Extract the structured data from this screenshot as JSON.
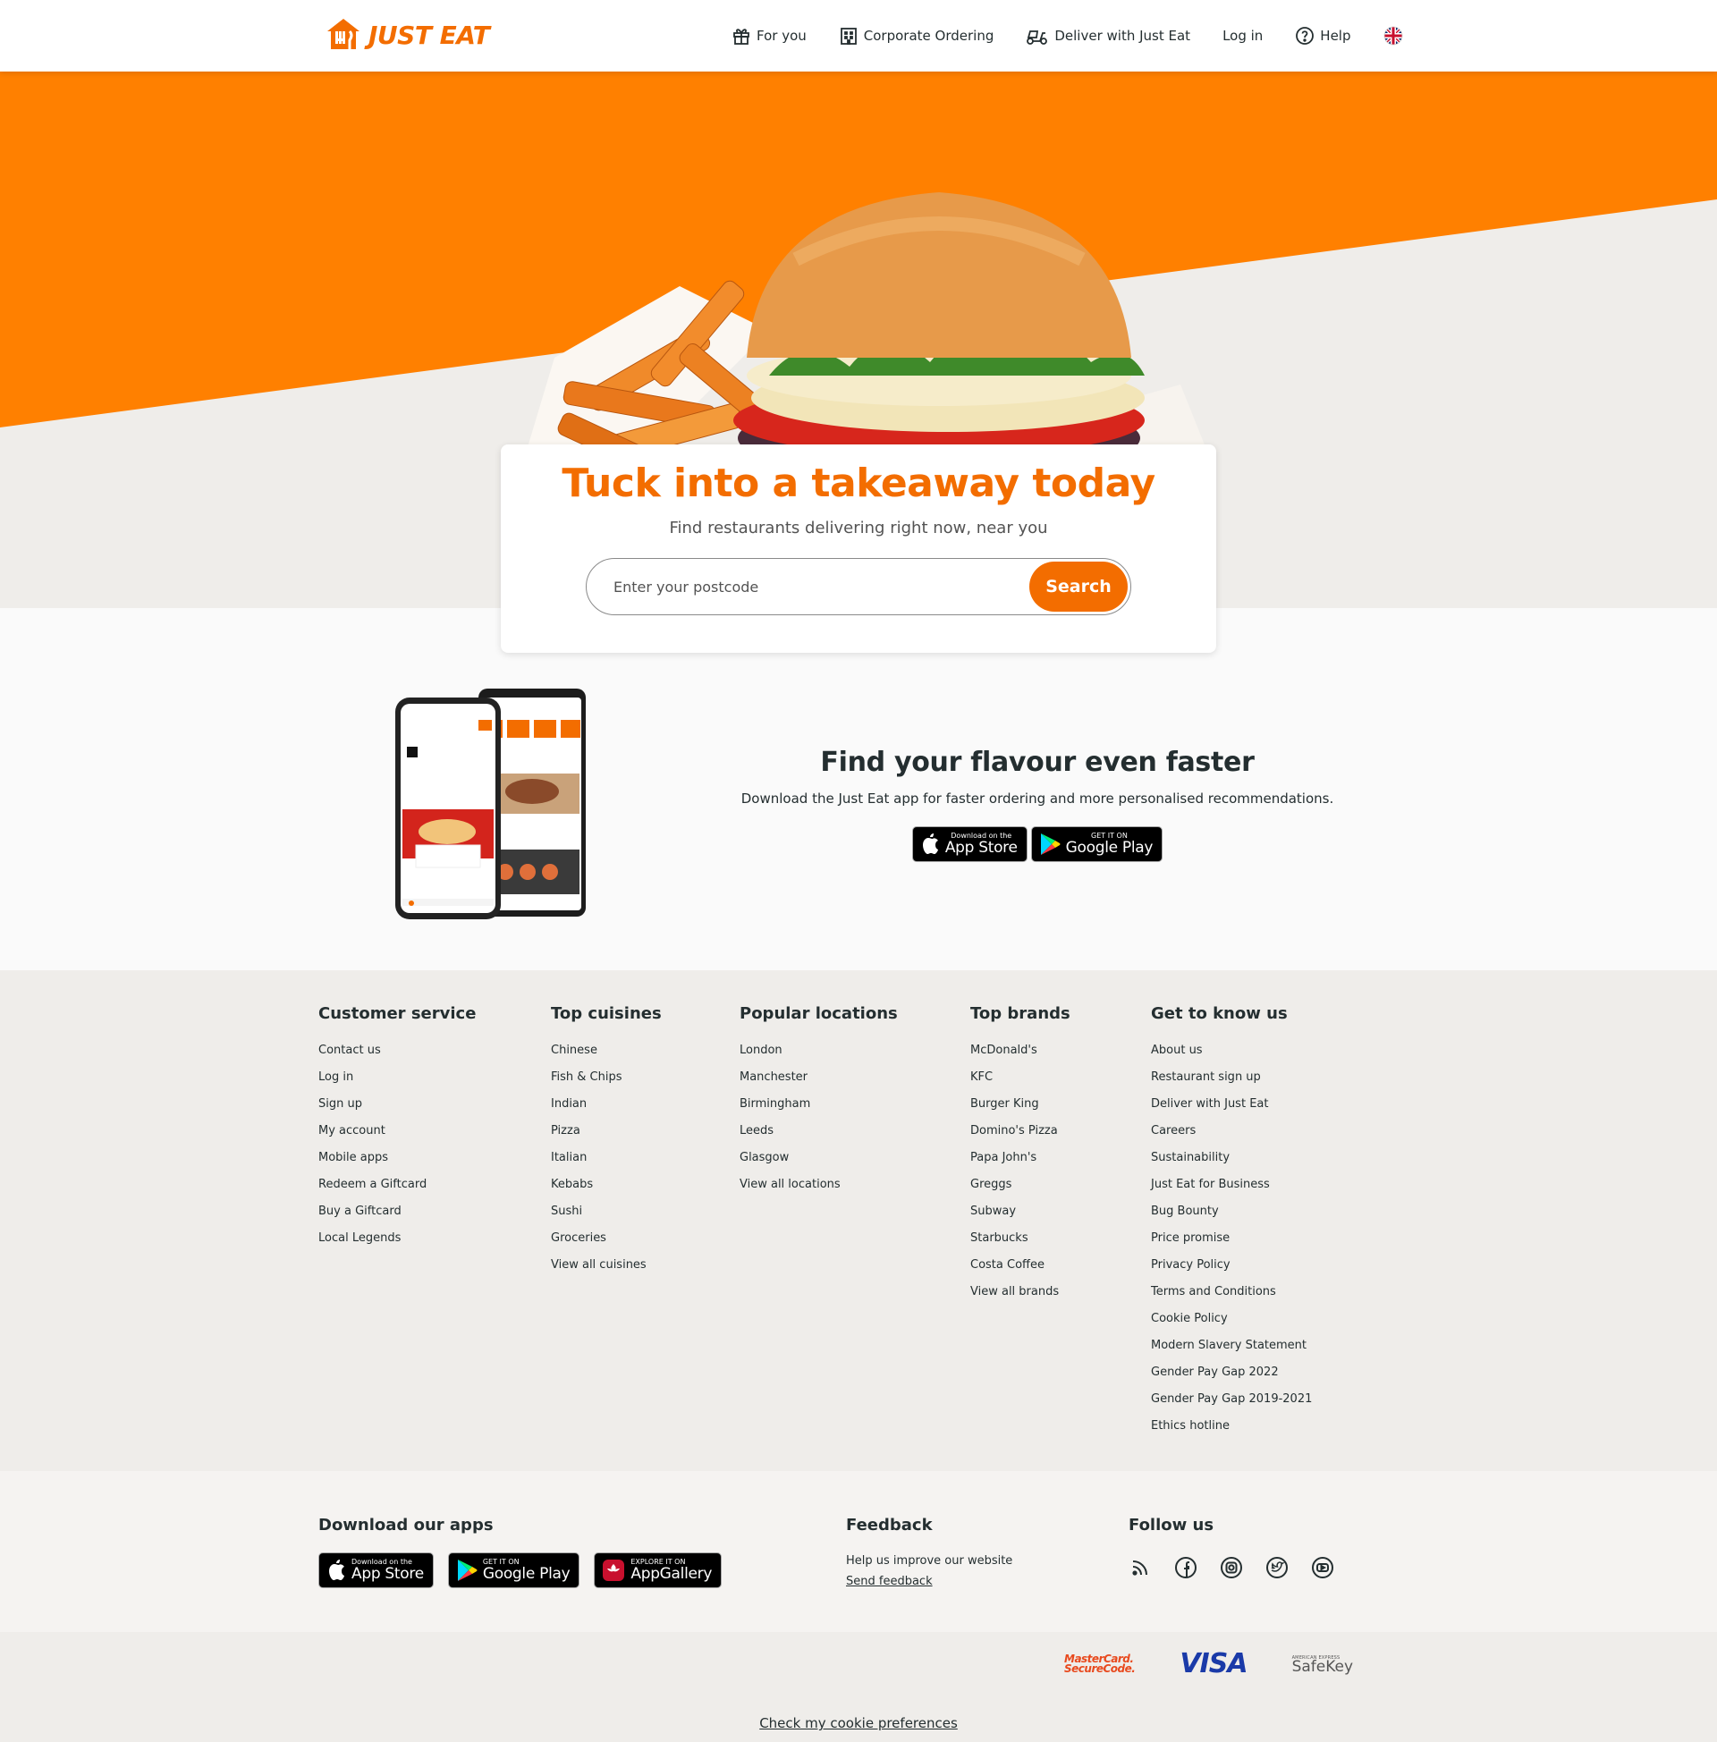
{
  "header": {
    "logo_text": "JUST EAT",
    "nav": {
      "for_you": "For you",
      "corporate": "Corporate Ordering",
      "deliver": "Deliver with Just Eat",
      "login": "Log in",
      "help": "Help"
    },
    "language_icon": "uk-flag-icon"
  },
  "hero": {
    "title": "Tuck into a takeaway today",
    "subtitle": "Find restaurants delivering right now, near you",
    "search": {
      "placeholder": "Enter your postcode",
      "value": "",
      "button_label": "Search"
    }
  },
  "app_promo": {
    "title": "Find your flavour even faster",
    "text": "Download the Just Eat app for faster ordering and more personalised recommendations.",
    "app_store": {
      "small": "Download on the",
      "big": "App Store"
    },
    "google_play": {
      "small": "GET IT ON",
      "big": "Google Play"
    }
  },
  "footer": {
    "columns": [
      {
        "title": "Customer service",
        "links": [
          "Contact us",
          "Log in",
          "Sign up",
          "My account",
          "Mobile apps",
          "Redeem a Giftcard",
          "Buy a Giftcard",
          "Local Legends"
        ]
      },
      {
        "title": "Top cuisines",
        "links": [
          "Chinese",
          "Fish & Chips",
          "Indian",
          "Pizza",
          "Italian",
          "Kebabs",
          "Sushi",
          "Groceries",
          "View all cuisines"
        ]
      },
      {
        "title": "Popular locations",
        "links": [
          "London",
          "Manchester",
          "Birmingham",
          "Leeds",
          "Glasgow",
          "View all locations"
        ]
      },
      {
        "title": "Top brands",
        "links": [
          "McDonald's",
          "KFC",
          "Burger King",
          "Domino's Pizza",
          "Papa John's",
          "Greggs",
          "Subway",
          "Starbucks",
          "Costa Coffee",
          "View all brands"
        ]
      },
      {
        "title": "Get to know us",
        "links": [
          "About us",
          "Restaurant sign up",
          "Deliver with Just Eat",
          "Careers",
          "Sustainability",
          "Just Eat for Business",
          "Bug Bounty",
          "Price promise",
          "Privacy Policy",
          "Terms and Conditions",
          "Cookie Policy",
          "Modern Slavery Statement",
          "Gender Pay Gap 2022",
          "Gender Pay Gap 2019-2021",
          "Ethics hotline"
        ]
      }
    ],
    "download": {
      "title": "Download our apps",
      "app_store": {
        "small": "Download on the",
        "big": "App Store"
      },
      "google_play": {
        "small": "GET IT ON",
        "big": "Google Play"
      },
      "app_gallery": {
        "small": "EXPLORE IT ON",
        "big": "AppGallery"
      }
    },
    "feedback": {
      "title": "Feedback",
      "text": "Help us improve our website",
      "link": "Send feedback"
    },
    "follow": {
      "title": "Follow us",
      "icons": [
        "rss-icon",
        "facebook-icon",
        "instagram-icon",
        "twitter-icon",
        "youtube-icon"
      ]
    },
    "payments": {
      "mastercard_line1": "MasterCard.",
      "mastercard_line2": "SecureCode.",
      "visa": "VISA",
      "safekey_top": "AMERICAN EXPRESS",
      "safekey": "SafeKey"
    },
    "cookie_link": "Check my cookie preferences"
  },
  "colors": {
    "brand_orange": "#f36d00",
    "text": "#242e30",
    "footer_bg": "#efedea"
  }
}
